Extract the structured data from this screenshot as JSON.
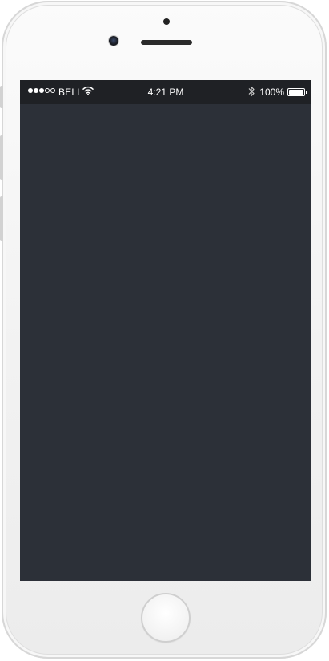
{
  "device": {
    "status_bar": {
      "carrier": "BELL",
      "time": "4:21 PM",
      "battery_percent": "100%",
      "battery_level": 1.0,
      "signal_strength": {
        "filled": 3,
        "total": 5
      },
      "icons": [
        "signal-dots-icon",
        "wifi-icon",
        "bluetooth-icon",
        "battery-icon"
      ]
    },
    "colors": {
      "screen": "#2c3038",
      "status_bar_bg": "#1f2125",
      "status_text": "#ffffff"
    }
  }
}
